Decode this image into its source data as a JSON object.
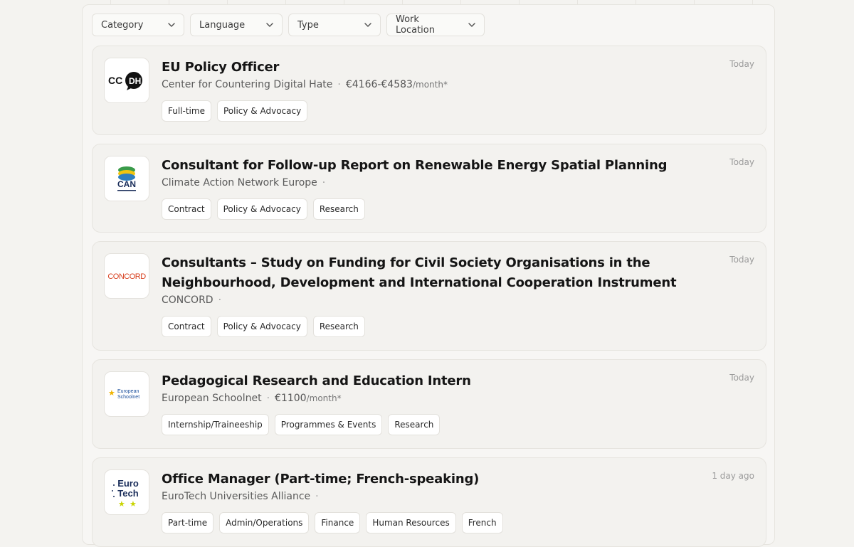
{
  "filters": [
    {
      "label": "Category"
    },
    {
      "label": "Language"
    },
    {
      "label": "Type"
    },
    {
      "label": "Work Location"
    }
  ],
  "jobs": [
    {
      "title": "EU Policy Officer",
      "org": "Center for Countering Digital Hate",
      "salary": "€4166-€4583",
      "salary_unit": "/month*",
      "date": "Today",
      "logo_text": [
        "CC",
        "DH"
      ],
      "tags": [
        "Full-time",
        "Policy & Advocacy"
      ]
    },
    {
      "title": "Consultant for Follow-up Report on Renewable Energy Spatial Planning",
      "org": "Climate Action Network Europe",
      "date": "Today",
      "logo_text": [
        "CAN"
      ],
      "tags": [
        "Contract",
        "Policy & Advocacy",
        "Research"
      ]
    },
    {
      "title": "Consultants – Study on Funding for Civil Society Organisations in the Neighbourhood, Development and International Cooperation Instrument",
      "org": "CONCORD",
      "date": "Today",
      "logo_text": [
        "CONCORD"
      ],
      "tags": [
        "Contract",
        "Policy & Advocacy",
        "Research"
      ]
    },
    {
      "title": "Pedagogical Research and Education Intern",
      "org": "European Schoolnet",
      "salary": "€1100",
      "salary_unit": "/month*",
      "date": "Today",
      "logo_text": [
        "European",
        "Schoolnet"
      ],
      "tags": [
        "Internship/Traineeship",
        "Programmes & Events",
        "Research"
      ]
    },
    {
      "title": "Office Manager (Part-time; French-speaking)",
      "org": "EuroTech Universities Alliance",
      "date": "1 day ago",
      "logo_text": [
        "Euro",
        "Tech"
      ],
      "tags": [
        "Part-time",
        "Admin/Operations",
        "Finance",
        "Human Resources",
        "French"
      ]
    }
  ],
  "separator": "·",
  "colors": {
    "accent": "#1d1d1f",
    "card_bg": "#f3f2ef",
    "page_bg": "#f4f3f0"
  }
}
